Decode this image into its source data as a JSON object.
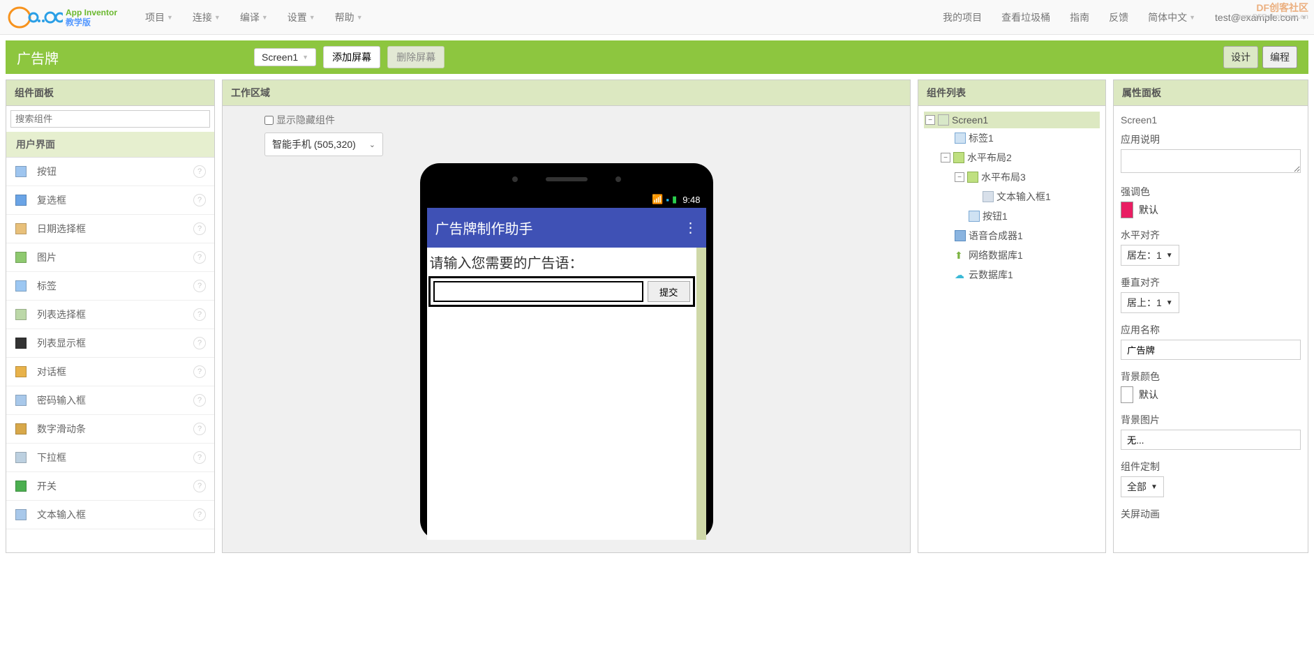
{
  "topbar": {
    "logo_upper": "App Inventor",
    "logo_lower": "教学版",
    "menus": [
      "项目",
      "连接",
      "编译",
      "设置",
      "帮助"
    ],
    "right_links": [
      "我的项目",
      "查看垃圾桶",
      "指南",
      "反馈"
    ],
    "lang": "简体中文",
    "user": "test@example.com"
  },
  "watermark": {
    "line1": "DF创客社区",
    "line2": "www.DFRobot.com.cn"
  },
  "greenbar": {
    "title": "广告牌",
    "screen_select": "Screen1",
    "add_screen": "添加屏幕",
    "delete_screen": "删除屏幕",
    "design": "设计",
    "blocks": "编程"
  },
  "palette": {
    "header": "组件面板",
    "search_placeholder": "搜索组件",
    "category": "用户界面",
    "items": [
      {
        "label": "按钮",
        "icon": "#9ec5ef"
      },
      {
        "label": "复选框",
        "icon": "#6aa4e6"
      },
      {
        "label": "日期选择框",
        "icon": "#e8c07a"
      },
      {
        "label": "图片",
        "icon": "#8ec96f"
      },
      {
        "label": "标签",
        "icon": "#9cc7f2"
      },
      {
        "label": "列表选择框",
        "icon": "#bcd8a8"
      },
      {
        "label": "列表显示框",
        "icon": "#333"
      },
      {
        "label": "对话框",
        "icon": "#e8b24a"
      },
      {
        "label": "密码输入框",
        "icon": "#a8c8ea"
      },
      {
        "label": "数字滑动条",
        "icon": "#d8a84a"
      },
      {
        "label": "下拉框",
        "icon": "#bcd0e0"
      },
      {
        "label": "开关",
        "icon": "#4caf50"
      },
      {
        "label": "文本输入框",
        "icon": "#a8c8ea"
      }
    ]
  },
  "workspace": {
    "header": "工作区域",
    "show_hidden": "显示隐藏组件",
    "device_select": "智能手机 (505,320)",
    "status_time": "9:48",
    "appbar_title": "广告牌制作助手",
    "prompt_label": "请输入您需要的广告语：",
    "submit_btn": "提交"
  },
  "components": {
    "header": "组件列表",
    "tree": {
      "screen": "Screen1",
      "label1": "标签1",
      "hlayout2": "水平布局2",
      "hlayout3": "水平布局3",
      "textbox1": "文本输入框1",
      "button1": "按钮1",
      "tts1": "语音合成器1",
      "webdb1": "网络数据库1",
      "clouddb1": "云数据库1"
    }
  },
  "properties": {
    "header": "属性面板",
    "screen": "Screen1",
    "app_desc_label": "应用说明",
    "accent_label": "强调色",
    "accent_value": "默认",
    "accent_color": "#e91e63",
    "halign_label": "水平对齐",
    "halign_value": "居左：1",
    "valign_label": "垂直对齐",
    "valign_value": "居上：1",
    "appname_label": "应用名称",
    "appname_value": "广告牌",
    "bgcolor_label": "背景颜色",
    "bgcolor_value": "默认",
    "bgimage_label": "背景图片",
    "bgimage_value": "无...",
    "custom_label": "组件定制",
    "custom_value": "全部",
    "closeanim_label": "关屏动画"
  }
}
